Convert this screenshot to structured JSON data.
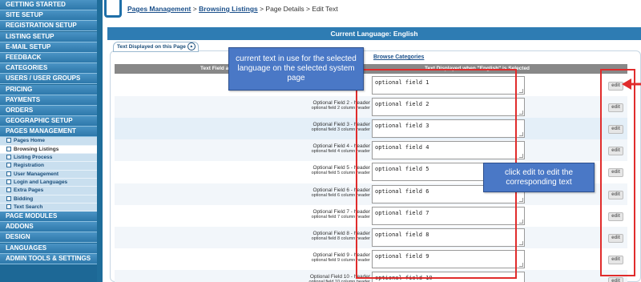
{
  "sidebar": {
    "top_items": [
      {
        "label": "GETTING STARTED"
      },
      {
        "label": "SITE SETUP"
      },
      {
        "label": "REGISTRATION SETUP"
      },
      {
        "label": "LISTING SETUP"
      },
      {
        "label": "E-MAIL SETUP"
      },
      {
        "label": "FEEDBACK"
      },
      {
        "label": "CATEGORIES"
      },
      {
        "label": "USERS / USER GROUPS"
      },
      {
        "label": "PRICING"
      },
      {
        "label": "PAYMENTS"
      },
      {
        "label": "ORDERS"
      },
      {
        "label": "GEOGRAPHIC SETUP"
      },
      {
        "label": "PAGES MANAGEMENT"
      }
    ],
    "sub_items": [
      {
        "label": "Pages Home"
      },
      {
        "label": "Browsing Listings"
      },
      {
        "label": "Listing Process"
      },
      {
        "label": "Registration"
      },
      {
        "label": "User Management"
      },
      {
        "label": "Login and Languages"
      },
      {
        "label": "Extra Pages"
      },
      {
        "label": "Bidding"
      },
      {
        "label": "Text Search"
      }
    ],
    "bottom_items": [
      {
        "label": "PAGE MODULES"
      },
      {
        "label": "ADDONS"
      },
      {
        "label": "DESIGN"
      },
      {
        "label": "LANGUAGES"
      },
      {
        "label": "ADMIN TOOLS & SETTINGS"
      }
    ]
  },
  "breadcrumb": {
    "pages_management": "Pages Management",
    "sep1": " > ",
    "browsing_listings": "Browsing Listings",
    "sep2": " > ",
    "page_details": "Page Details",
    "sep3": " > ",
    "edit_text": "Edit Text"
  },
  "language_bar": "Current Language: English",
  "section_tab": {
    "label": "Text Displayed on this Page",
    "toggle": "▲"
  },
  "browse_link": "Browse Categories",
  "table": {
    "col_field": "Text Field a",
    "col_text": "Text Displayed when \"English\" is Selected",
    "rows": [
      {
        "name": "",
        "desc": "",
        "value": "optional field 1",
        "edit": "edit"
      },
      {
        "name": "Optional Field 2 - header",
        "desc": "optional field 2 column header",
        "value": "optional field 2",
        "edit": "edit"
      },
      {
        "name": "Optional Field 3 - header",
        "desc": "optional field 3 column header",
        "value": "optional field 3",
        "edit": "edit"
      },
      {
        "name": "Optional Field 4 - header",
        "desc": "optional field 4 column header",
        "value": "optional field 4",
        "edit": "edit"
      },
      {
        "name": "Optional Field 5 - header",
        "desc": "optional field 5 column header",
        "value": "optional field 5",
        "edit": "edit"
      },
      {
        "name": "Optional Field 6 - header",
        "desc": "optional field 6 column header",
        "value": "optional field 6",
        "edit": "edit"
      },
      {
        "name": "Optional Field 7 - header",
        "desc": "optional field 7 column header",
        "value": "optional field 7",
        "edit": "edit"
      },
      {
        "name": "Optional Field 8 - header",
        "desc": "optional field 8 column header",
        "value": "optional field 8",
        "edit": "edit"
      },
      {
        "name": "Optional Field 9 - header",
        "desc": "optional field 9 column header",
        "value": "optional field 9",
        "edit": "edit"
      },
      {
        "name": "Optional Field 10 - header",
        "desc": "optional field 10 column header",
        "value": "optional field 10",
        "edit": "edit"
      }
    ]
  },
  "callouts": {
    "current_text": "current text in use for the selected language on the selected system page",
    "edit_hint": "click edit to edit the corresponding text"
  },
  "colors": {
    "sidebar_bg": "#1d6896",
    "header_bar": "#2e7cb3",
    "annotation_red": "#e02c2c",
    "callout_blue": "#4a78c6"
  }
}
